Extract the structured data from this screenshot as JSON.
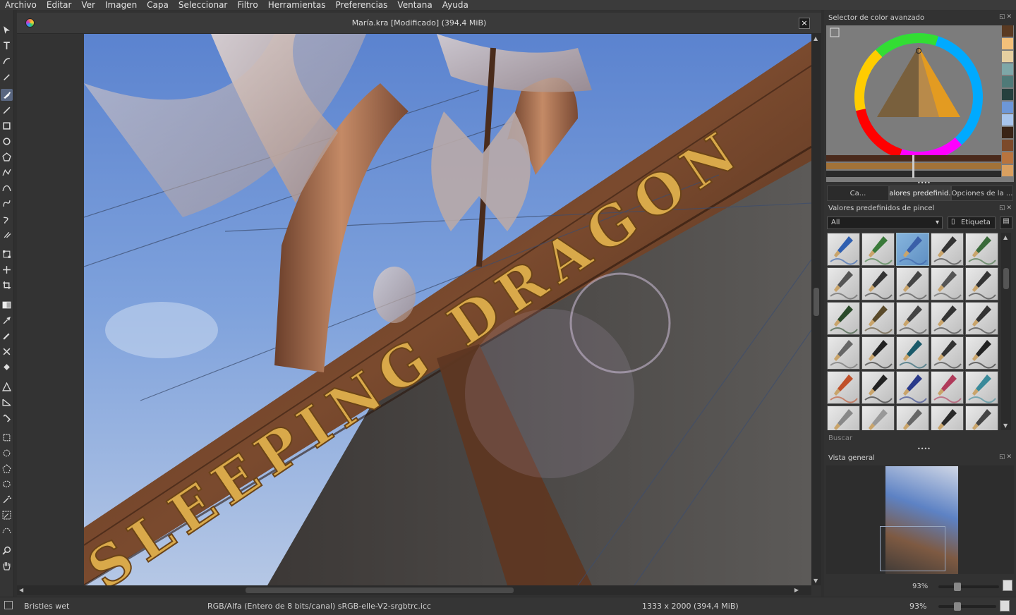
{
  "menu": [
    "Archivo",
    "Editar",
    "Ver",
    "Imagen",
    "Capa",
    "Seleccionar",
    "Filtro",
    "Herramientas",
    "Preferencias",
    "Ventana",
    "Ayuda"
  ],
  "document": {
    "title": "María.kra [Modificado]  (394,4 MiB)",
    "close": "×"
  },
  "canvas": {
    "banner_text": "SLEEPING DRAGON"
  },
  "color_selector": {
    "title": "Selector de color avanzado"
  },
  "swatches": [
    "#5a3a22",
    "#f2c07a",
    "#e6cfa0",
    "#7ea7a8",
    "#4f7a78",
    "#26403e",
    "#6d97d8",
    "#a8c5ec",
    "#3a2416",
    "#7c4a2a",
    "#b8743e",
    "#d9a060"
  ],
  "dock_tabs": [
    "Ca...",
    "Valores predefinid...",
    "Opciones de la ..."
  ],
  "brush_presets": {
    "title": "Valores predefinidos de pincel",
    "filter_value": "All",
    "tag_label": "Etiqueta",
    "search_placeholder": "Buscar"
  },
  "overview": {
    "title": "Vista general",
    "zoom": "93%"
  },
  "status": {
    "brush_name": "Bristles wet",
    "color_space": "RGB/Alfa (Entero de 8 bits/canal)  sRGB-elle-V2-srgbtrc.icc",
    "image_size": "1333 x 2000 (394,4 MiB)",
    "zoom": "93%"
  }
}
